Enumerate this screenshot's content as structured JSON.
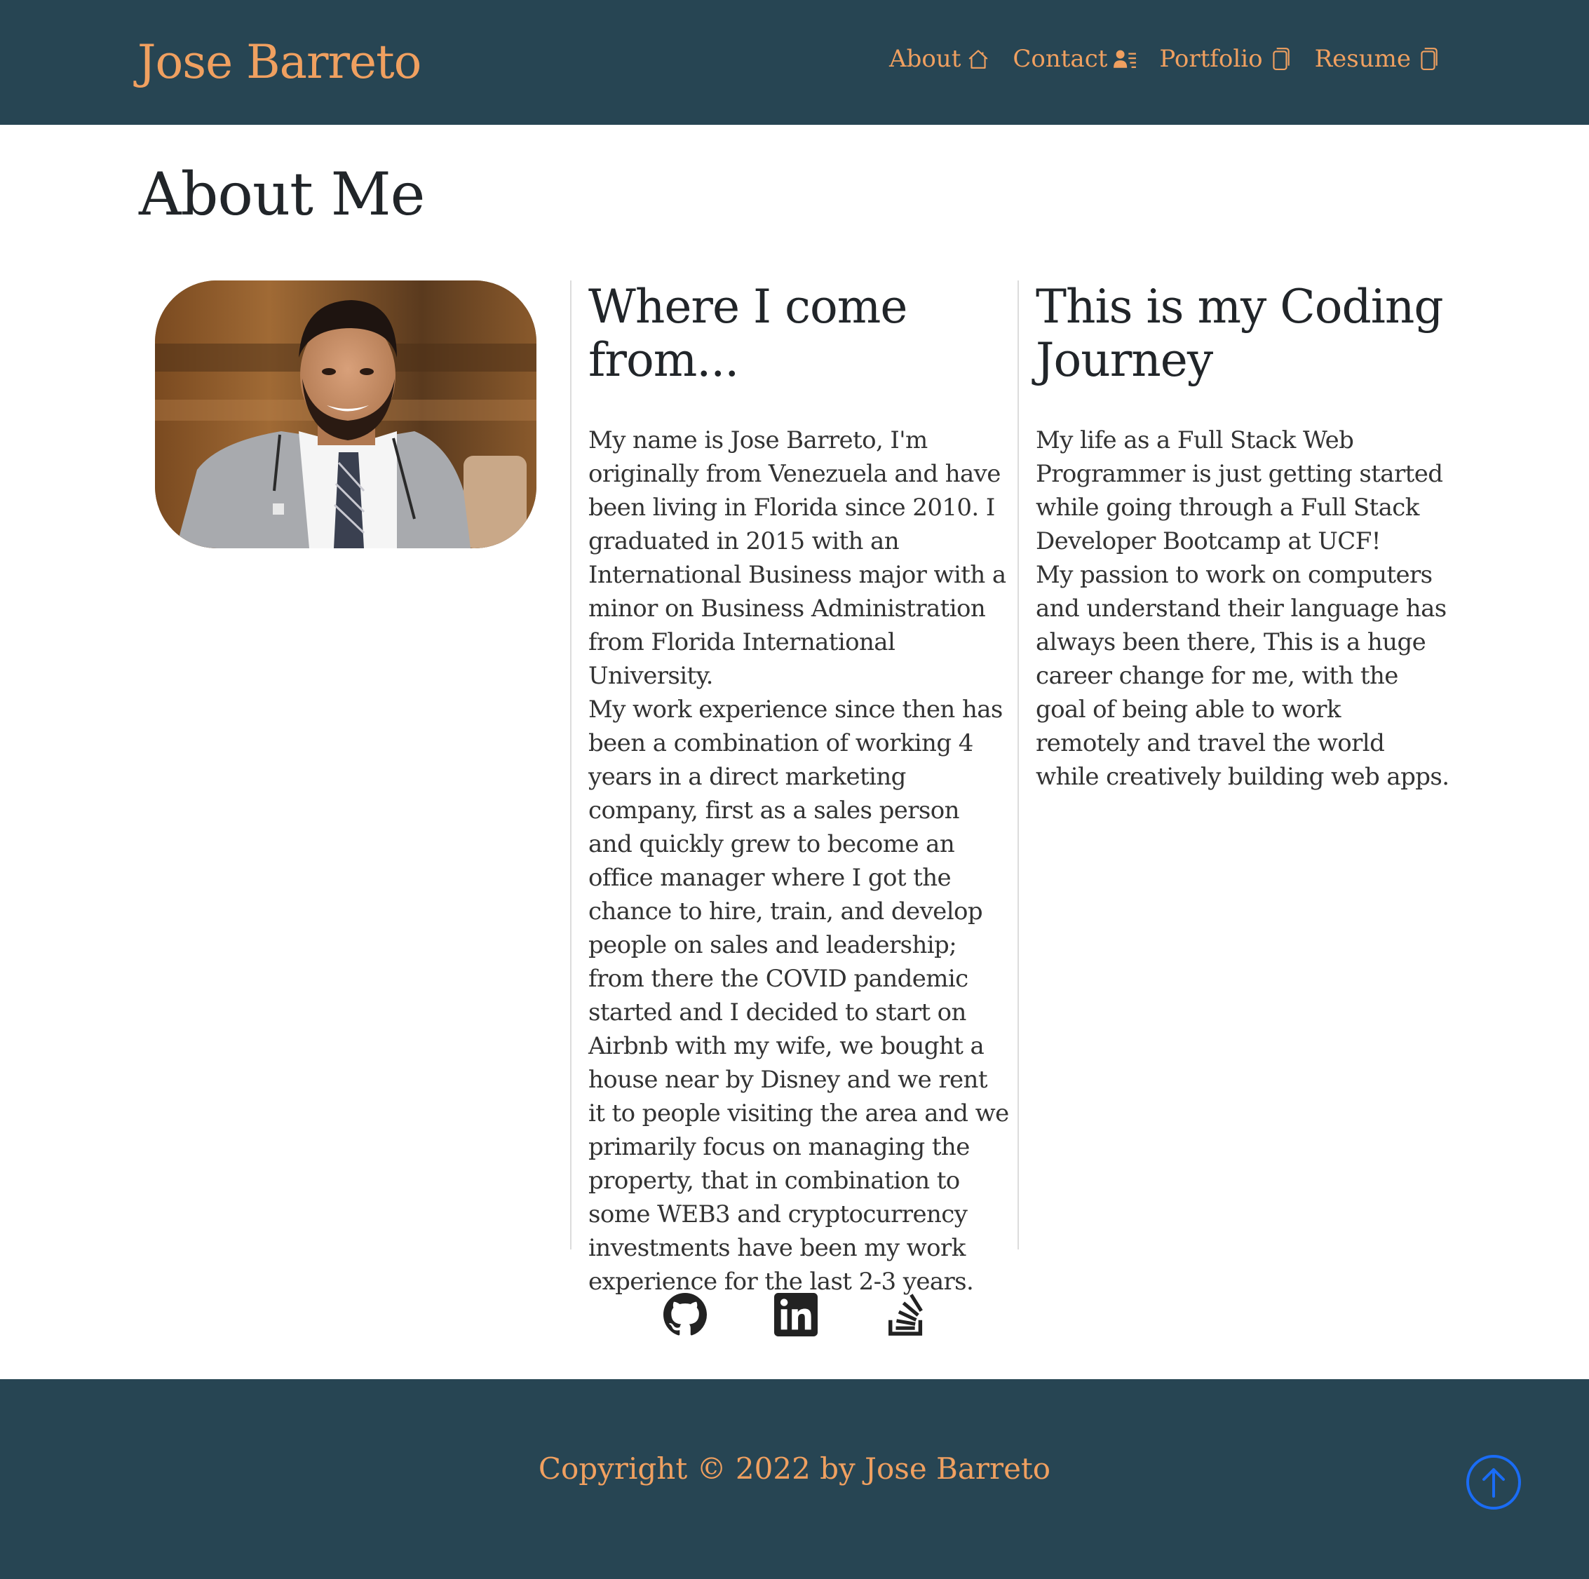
{
  "header": {
    "brand": "Jose Barreto",
    "nav": [
      {
        "label": "About",
        "icon": "house-icon"
      },
      {
        "label": "Contact",
        "icon": "person-lines-icon"
      },
      {
        "label": "Portfolio",
        "icon": "files-icon"
      },
      {
        "label": "Resume",
        "icon": "files-icon"
      }
    ]
  },
  "main": {
    "title": "About Me",
    "photo_alt": "profile-photo",
    "columns": [
      {
        "heading_line1": "Where I come",
        "heading_line2": "from...",
        "text": "My name is Jose Barreto, I'm originally from Venezuela and have been living in Florida since 2010. I graduated in 2015 with an International Business major with a minor on Business Administration from Florida International University.",
        "text2": "My work experience since then has been a combination of working 4 years in a direct marketing company, first as a sales person and quickly grew to become an office manager where I got the chance to hire, train, and develop people on sales and leadership; from there the COVID pandemic started and I decided to start on Airbnb with my wife, we bought a house near by Disney and we rent it to people visiting the area and we primarily focus on managing the property, that in combination to some WEB3 and cryptocurrency investments have been my work experience for the last 2-3 years."
      },
      {
        "heading_line1": "This is my Coding",
        "heading_line2": "Journey",
        "text": "My life as a Full Stack Web Programmer is just getting started while going through a Full Stack Developer Bootcamp at UCF!",
        "text2": "My passion to work on computers and understand their language has always been there, This is a huge career change for me, with the goal of being able to work remotely and travel the world while creatively building web apps."
      }
    ]
  },
  "social": [
    {
      "icon": "github-icon"
    },
    {
      "icon": "linkedin-icon"
    },
    {
      "icon": "stackoverflow-icon"
    }
  ],
  "footer": {
    "copyright": "Copyright © 2022 by Jose Barreto",
    "to_top_icon": "arrow-up-circle-icon"
  },
  "colors": {
    "header_bg": "#274553",
    "accent": "#f0a060",
    "to_top": "#1a6cf5"
  }
}
